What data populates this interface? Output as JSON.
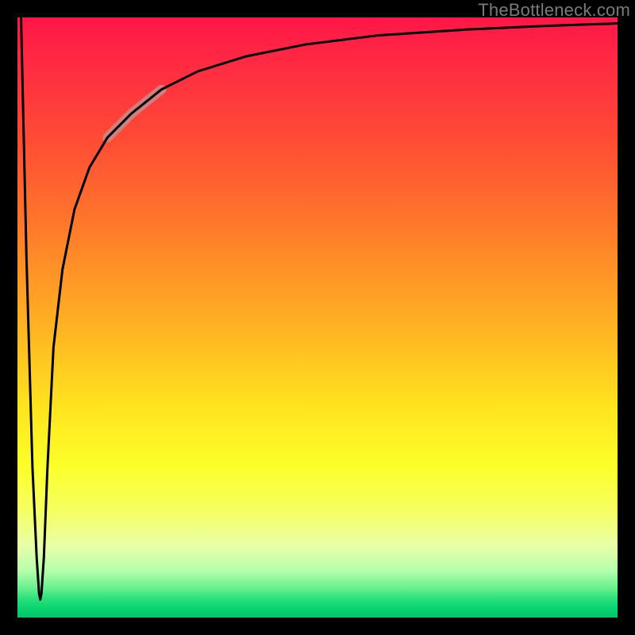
{
  "attribution": "TheBottleneck.com",
  "chart_data": {
    "type": "line",
    "title": "",
    "xlabel": "",
    "ylabel": "",
    "xlim": [
      0,
      100
    ],
    "ylim": [
      0,
      100
    ],
    "gradient_meaning": "bottleneck severity (red high, green low)",
    "series": [
      {
        "name": "bottleneck-curve",
        "x": [
          0.6,
          1.5,
          2.5,
          3.2,
          3.6,
          3.8,
          4.0,
          4.4,
          5.0,
          6.0,
          7.5,
          9.5,
          12.0,
          15.0,
          19.0,
          24.0,
          30.0,
          38.0,
          48.0,
          60.0,
          75.0,
          88.0,
          100.0
        ],
        "values": [
          100,
          60,
          25,
          10,
          4,
          3,
          4,
          10,
          25,
          45,
          58,
          68,
          75,
          80,
          84,
          88,
          91,
          93.5,
          95.5,
          97,
          98,
          98.6,
          99
        ]
      },
      {
        "name": "highlighted-segment",
        "x": [
          15.0,
          19.0,
          24.0
        ],
        "values": [
          80,
          84,
          88
        ]
      }
    ]
  }
}
